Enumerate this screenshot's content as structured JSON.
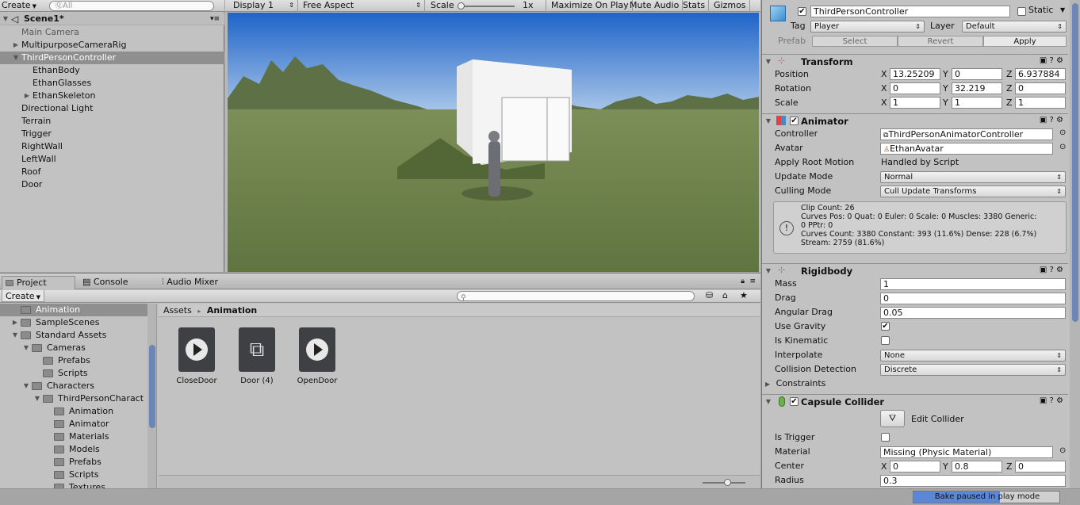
{
  "hierarchy": {
    "create": "Create",
    "search_placeholder": "ⓆAll",
    "scene": "Scene1*",
    "items": [
      "Main Camera",
      "MultipurposeCameraRig",
      "ThirdPersonController",
      "EthanBody",
      "EthanGlasses",
      "EthanSkeleton",
      "Directional Light",
      "Terrain",
      "Trigger",
      "RightWall",
      "LeftWall",
      "Roof",
      "Door"
    ]
  },
  "game": {
    "display": "Display 1",
    "aspect": "Free Aspect",
    "scale_label": "Scale",
    "scale_value": "1x",
    "maximize": "Maximize On Play",
    "mute": "Mute Audio",
    "stats": "Stats",
    "gizmos": "Gizmos"
  },
  "project": {
    "tabs": [
      "Project",
      "Console",
      "Audio Mixer"
    ],
    "create": "Create",
    "tree": [
      "Animation",
      "SampleScenes",
      "Standard Assets",
      "Cameras",
      "Prefabs",
      "Scripts",
      "Characters",
      "ThirdPersonCharact",
      "Animation",
      "Animator",
      "Materials",
      "Models",
      "Prefabs",
      "Scripts",
      "Textures"
    ],
    "breadcrumb_root": "Assets",
    "breadcrumb_sep": "▸",
    "breadcrumb_current": "Animation",
    "assets": [
      "CloseDoor",
      "Door (4)",
      "OpenDoor"
    ]
  },
  "inspector": {
    "object_name": "ThirdPersonController",
    "static": "Static",
    "tag_label": "Tag",
    "tag": "Player",
    "layer_label": "Layer",
    "layer": "Default",
    "prefab": "Prefab",
    "select": "Select",
    "revert": "Revert",
    "apply": "Apply",
    "transform": {
      "title": "Transform",
      "position": "Position",
      "rotation": "Rotation",
      "scale": "Scale",
      "px": "13.25209",
      "py": "0",
      "pz": "6.937884",
      "rx": "0",
      "ry": "32.219",
      "rz": "0",
      "sx": "1",
      "sy": "1",
      "sz": "1"
    },
    "animator": {
      "title": "Animator",
      "controller_label": "Controller",
      "controller": "ThirdPersonAnimatorController",
      "avatar_label": "Avatar",
      "avatar": "EthanAvatar",
      "root_label": "Apply Root Motion",
      "root": "Handled by Script",
      "update_label": "Update Mode",
      "update": "Normal",
      "culling_label": "Culling Mode",
      "culling": "Cull Update Transforms",
      "info": [
        "Clip Count: 26",
        "Curves Pos: 0 Quat: 0 Euler: 0 Scale: 0 Muscles: 3380 Generic:",
        "0 PPtr: 0",
        "Curves Count: 3380 Constant: 393 (11.6%) Dense: 228 (6.7%)",
        "Stream: 2759 (81.6%)"
      ]
    },
    "rigidbody": {
      "title": "Rigidbody",
      "mass_label": "Mass",
      "mass": "1",
      "drag_label": "Drag",
      "drag": "0",
      "adrag_label": "Angular Drag",
      "adrag": "0.05",
      "gravity_label": "Use Gravity",
      "kinematic_label": "Is Kinematic",
      "interp_label": "Interpolate",
      "interp": "None",
      "coll_label": "Collision Detection",
      "coll": "Discrete",
      "constraints": "Constraints"
    },
    "capsule": {
      "title": "Capsule Collider",
      "edit": "Edit Collider",
      "trigger_label": "Is Trigger",
      "material_label": "Material",
      "material": "Missing (Physic Material)",
      "center_label": "Center",
      "cx": "0",
      "cy": "0.8",
      "cz": "0",
      "radius_label": "Radius",
      "radius": "0.3"
    }
  },
  "status": {
    "bake": "Bake paused in play mode"
  }
}
